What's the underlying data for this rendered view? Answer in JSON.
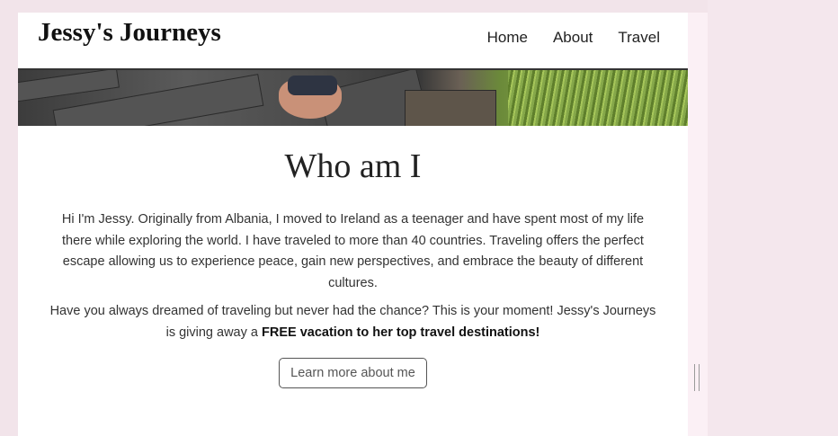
{
  "site": {
    "brand": "Jessy's Journeys"
  },
  "nav": {
    "items": [
      "Home",
      "About",
      "Travel"
    ]
  },
  "about": {
    "heading": "Who am I",
    "paragraph1": "Hi I'm Jessy. Originally from Albania, I moved to Ireland as a teenager and have spent most of my life there while exploring the world. I have traveled to more than 40 countries. Traveling offers the perfect escape allowing us to experience peace, gain new perspectives, and embrace the beauty of different cultures.",
    "paragraph2_lead": "Have you always dreamed of traveling but never had the chance? This is your moment! Jessy's Journeys is giving away a ",
    "paragraph2_highlight": "FREE vacation to her top travel destinations!",
    "cta_label": "Learn more about me"
  },
  "colors": {
    "page_bg": "#f2e4ea",
    "text": "#333333",
    "brand": "#111111"
  }
}
